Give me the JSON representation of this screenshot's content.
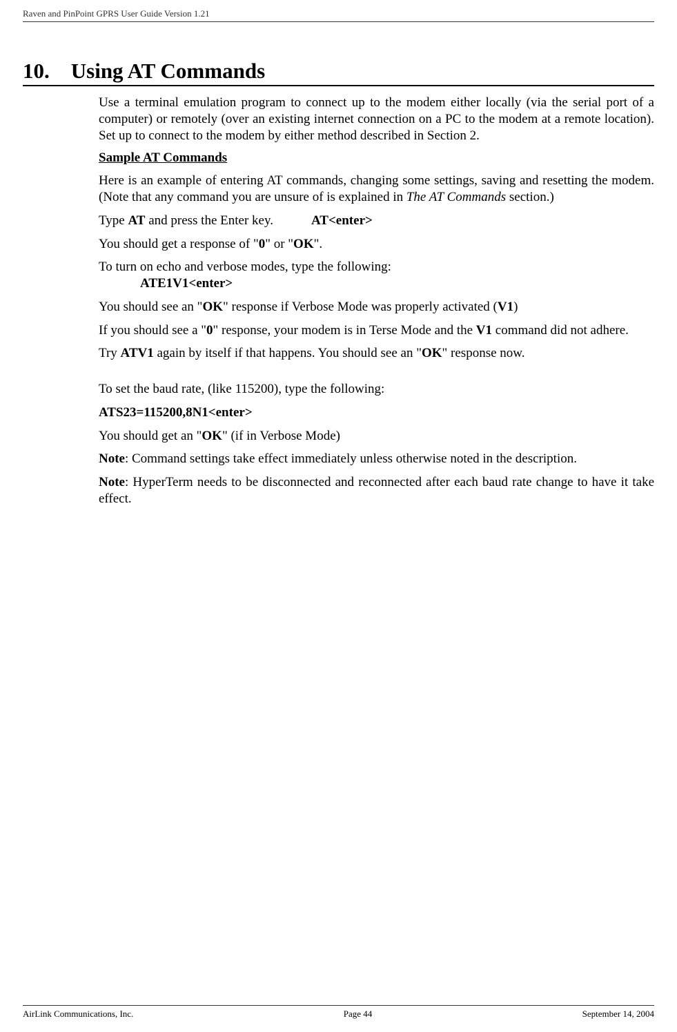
{
  "header": {
    "title": "Raven and PinPoint GPRS User Guide Version 1.21"
  },
  "section": {
    "number": "10.",
    "title": "Using AT Commands"
  },
  "paragraphs": {
    "intro": "Use a terminal emulation program to connect up to the modem either locally (via the serial port of a computer) or remotely (over an existing internet connection on a PC to the modem at a remote location). Set up to connect to the modem by either method described in Section 2.",
    "sample_heading": "Sample AT Commands",
    "sample_intro_1": "Here is an example of entering AT commands, changing some settings, saving and resetting the modem. (Note that any command you are unsure of is explained in ",
    "sample_intro_italic": "The AT Commands",
    "sample_intro_2": " section.)",
    "type_at_1": "Type ",
    "type_at_bold": "AT",
    "type_at_2": " and press the Enter key.",
    "at_enter": "AT<enter>",
    "response_1": "You should get a response of \"",
    "response_zero": "0",
    "response_2": "\" or \"",
    "response_ok": "OK",
    "response_3": "\".",
    "echo_1": "To turn on echo and verbose modes, type the following:",
    "ate1v1": "ATE1V1<enter>",
    "verbose_1": "You should see an \"",
    "verbose_ok": "OK",
    "verbose_2": "\" response if Verbose Mode was properly activated (",
    "verbose_v1": "V1",
    "verbose_3": ")",
    "terse_1": "If you should see a \"",
    "terse_zero": "0",
    "terse_2": "\" response, your modem is in Terse Mode and the ",
    "terse_v1": "V1",
    "terse_3": " command did not adhere.",
    "try_1": "Try ",
    "try_atv1": "ATV1",
    "try_2": " again by itself if that happens. You should see an \"",
    "try_ok": "OK",
    "try_3": "\" response now.",
    "baud_intro": "To set the baud rate, (like 115200), type the following:",
    "ats23": "ATS23=115200,8N1<enter>",
    "baud_resp_1": "You should get an \"",
    "baud_resp_ok": "OK",
    "baud_resp_2": "\" (if in Verbose Mode)",
    "note1_bold": "Note",
    "note1_text": ": Command settings take effect immediately unless otherwise noted in the description.",
    "note2_bold": "Note",
    "note2_text": ": HyperTerm needs to be disconnected and reconnected after each baud rate change to have it take effect."
  },
  "footer": {
    "left": "AirLink Communications, Inc.",
    "center": "Page 44",
    "right": "September 14, 2004"
  }
}
